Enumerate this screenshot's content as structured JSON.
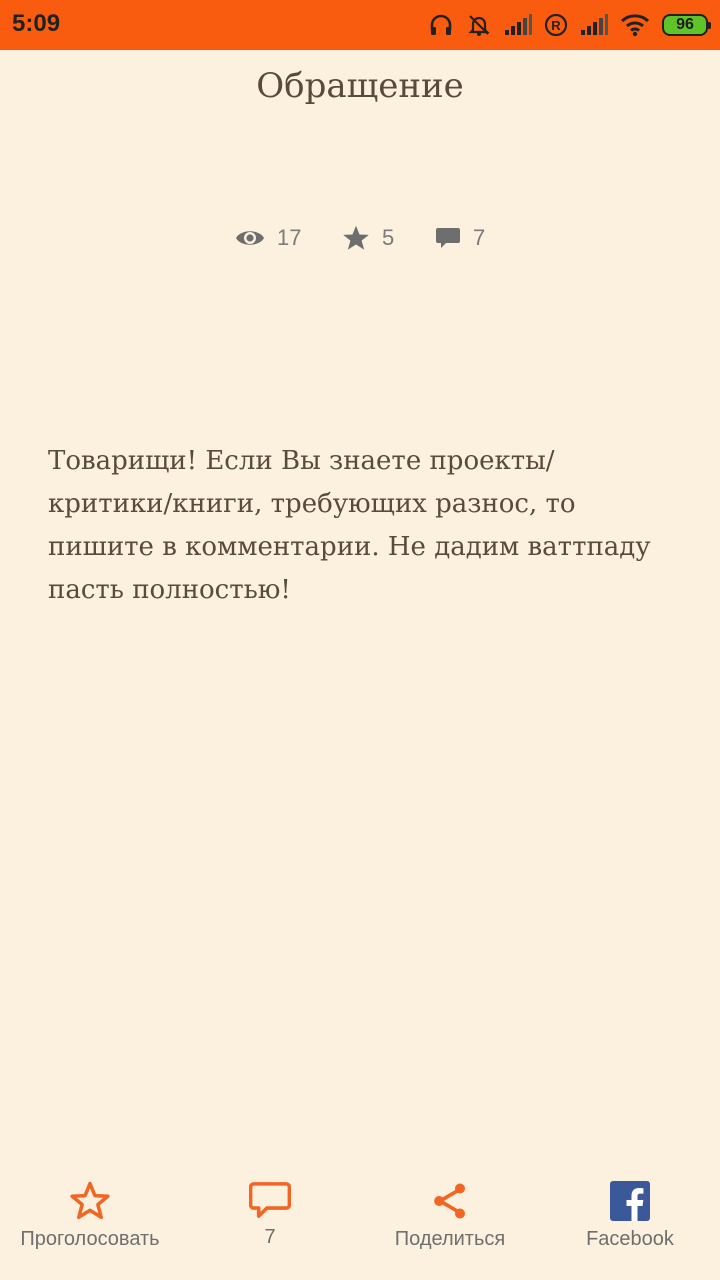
{
  "status_bar": {
    "time": "5:09",
    "battery": "96",
    "icons": [
      "headphones-icon",
      "bell-muted-icon",
      "signal-icon",
      "roaming-r-icon",
      "signal-icon",
      "wifi-icon",
      "battery-icon"
    ],
    "background_color": "#fa5c0f"
  },
  "story": {
    "title": "Обращение",
    "stats": {
      "views": "17",
      "votes": "5",
      "comments": "7"
    },
    "text": "Товарищи! Если Вы знаете проекты/ критики/книги, требующих разнос, то пишите в комментарии. Не дадим ваттпаду пасть полностью!"
  },
  "bottom_actions": {
    "vote_label": "Проголосовать",
    "comments_count": "7",
    "share_label": "Поделиться",
    "facebook_label": "Facebook"
  },
  "colors": {
    "background": "#fcf0de",
    "accent": "#f26522",
    "text": "#5a4a3d",
    "facebook": "#3b5998"
  }
}
